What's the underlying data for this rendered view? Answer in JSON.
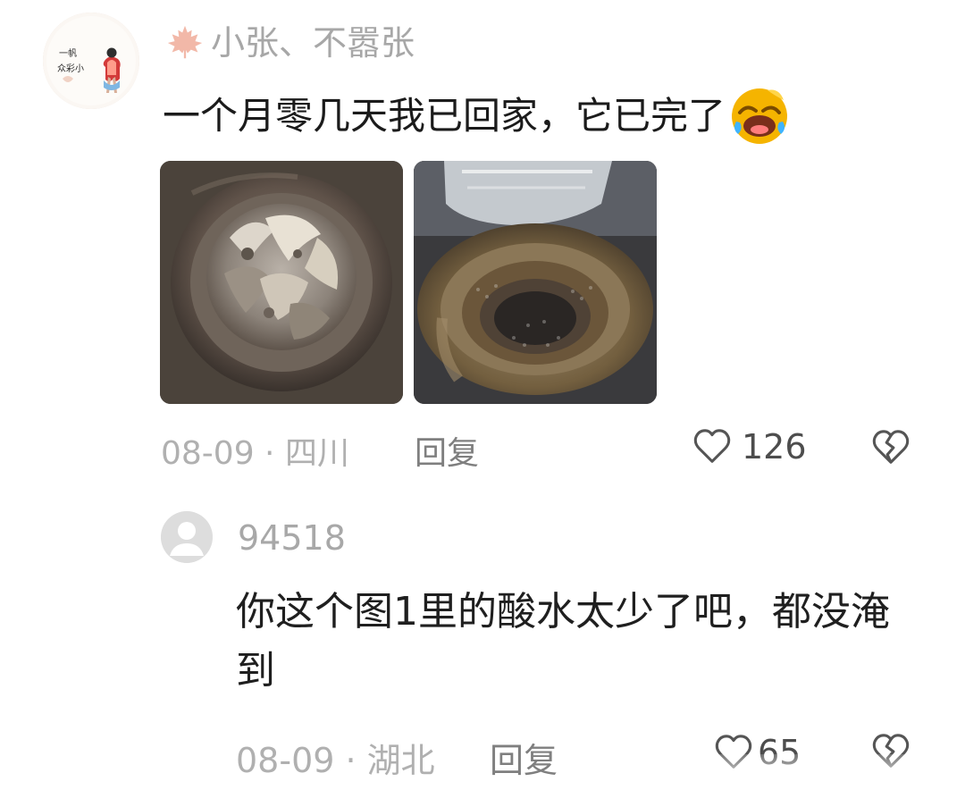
{
  "comment": {
    "avatar": {
      "icon": "profile-illustration-avatar",
      "lines": [
        "一帆",
        "众彩小"
      ]
    },
    "badge_icon": "maple-leaf-icon",
    "username": "小张、不嚣张",
    "text": "一个月零几天我已回家，它已完了",
    "emoji": "laughing-crying-emoji",
    "images": [
      {
        "name": "image-1"
      },
      {
        "name": "image-2"
      }
    ],
    "time_location": "08-09 · 四川",
    "reply_label": "回复",
    "likes": "126",
    "like_icon": "heart-outline-icon",
    "dislike_icon": "broken-heart-icon"
  },
  "reply": {
    "avatar_icon": "default-user-avatar",
    "username": "94518",
    "text": "你这个图1里的酸水太少了吧，都没淹到",
    "time_location": "08-09 · 湖北",
    "reply_label": "回复",
    "likes": "65",
    "like_icon": "heart-outline-icon",
    "dislike_icon": "broken-heart-icon"
  },
  "colors": {
    "background": "#ffffff",
    "primary_text": "#1f1f1f",
    "secondary_text": "#b0b0b0",
    "muted_text": "#7f7f7f",
    "avatar_placeholder": "#e2e2e2",
    "maple_leaf": "#f2b8a8",
    "emoji": "#f5b400"
  }
}
